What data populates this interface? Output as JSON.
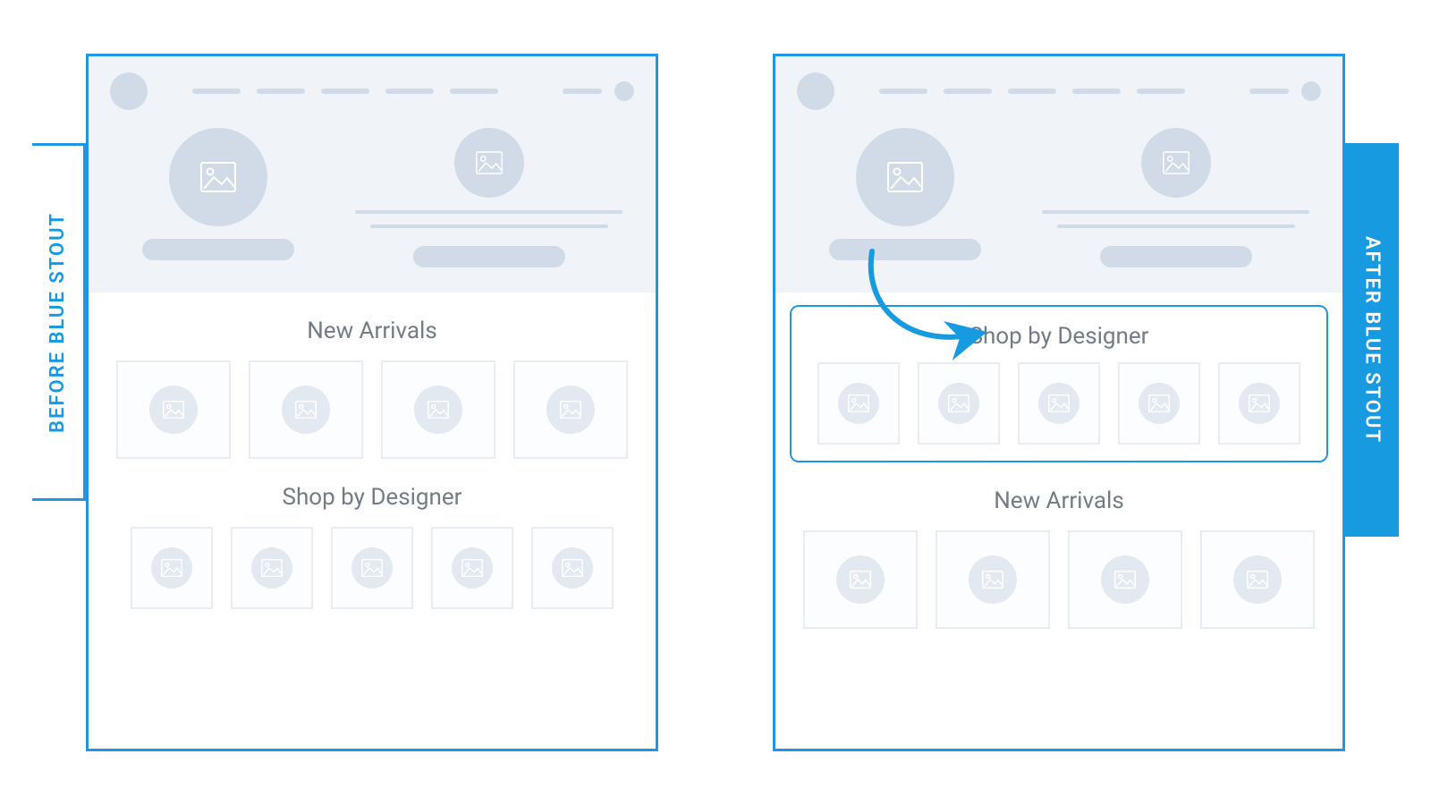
{
  "tabs": {
    "before": "BEFORE  BLUE STOUT",
    "after": "AFTER  BLUE STOUT"
  },
  "before_panel": {
    "section1_title": "New Arrivals",
    "section1_tiles": 4,
    "section2_title": "Shop by Designer",
    "section2_tiles": 5
  },
  "after_panel": {
    "highlight_title": "Shop by Designer",
    "highlight_tiles": 5,
    "section2_title": "New Arrivals",
    "section2_tiles": 4
  },
  "icons": {
    "image_placeholder": "image-icon"
  },
  "colors": {
    "accent": "#179ae0",
    "placeholder": "#d1dbe8"
  }
}
